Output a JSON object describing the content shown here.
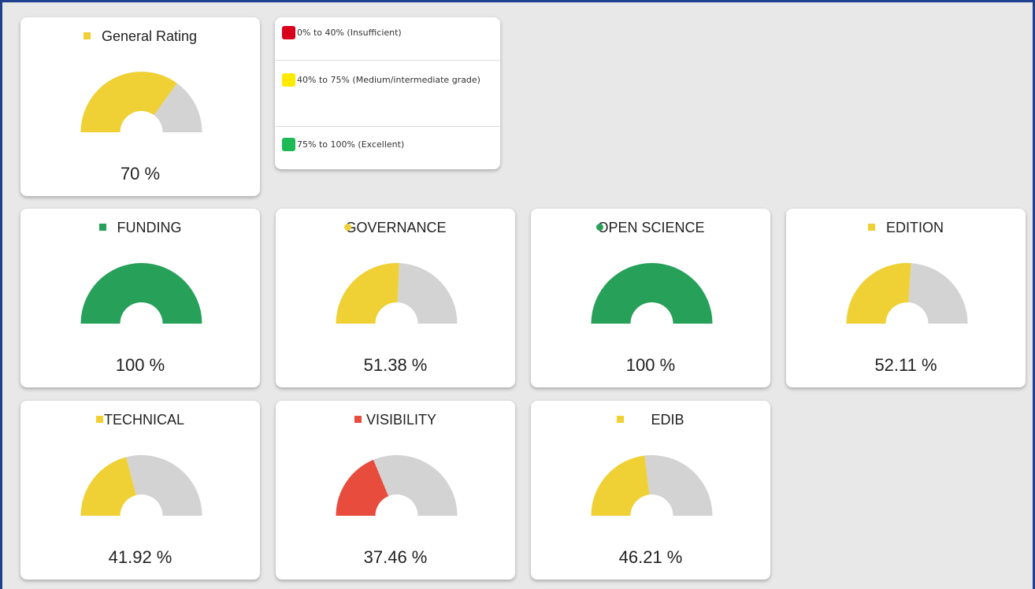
{
  "colors": {
    "insufficient": "#d9001b",
    "medium": "#ffea00",
    "excellent": "#1db954",
    "gauge_yellow": "#efd035",
    "gauge_green": "#27a05a",
    "gauge_red": "#e74c3c",
    "gauge_track": "#d3d3d3"
  },
  "legend": {
    "items": [
      {
        "label": "0% to 40% (Insufficient)",
        "color": "#d9001b"
      },
      {
        "label": "40% to 75% (Medium/intermediate grade)",
        "color": "#ffea00"
      },
      {
        "label": "75% to 100% (Excellent)",
        "color": "#1db954"
      }
    ]
  },
  "cards": [
    {
      "title": "General Rating",
      "percent": 70,
      "value_text": "70 %",
      "color": "#efd035",
      "marker": "square",
      "icon": "yellow-square-icon"
    },
    {
      "title": "FUNDING",
      "percent": 100,
      "value_text": "100 %",
      "color": "#27a05a",
      "marker": "square",
      "icon": "green-square-icon"
    },
    {
      "title": "GOVERNANCE",
      "percent": 51.38,
      "value_text": "51.38 %",
      "color": "#efd035",
      "marker": "round",
      "icon": "yellow-dot-icon"
    },
    {
      "title": "OPEN SCIENCE",
      "percent": 100,
      "value_text": "100 %",
      "color": "#27a05a",
      "marker": "round",
      "icon": "green-dot-icon"
    },
    {
      "title": "EDITION",
      "percent": 52.11,
      "value_text": "52.11 %",
      "color": "#efd035",
      "marker": "square",
      "icon": "yellow-square-icon"
    },
    {
      "title": "TECHNICAL",
      "percent": 41.92,
      "value_text": "41.92 %",
      "color": "#efd035",
      "marker": "square-tight",
      "icon": "yellow-square-icon"
    },
    {
      "title": "VISIBILITY",
      "percent": 37.46,
      "value_text": "37.46 %",
      "color": "#e74c3c",
      "marker": "square",
      "icon": "red-square-icon"
    },
    {
      "title": "EDIB",
      "percent": 46.21,
      "value_text": "46.21 %",
      "color": "#efd035",
      "marker": "square-wide",
      "icon": "yellow-square-icon"
    }
  ]
}
